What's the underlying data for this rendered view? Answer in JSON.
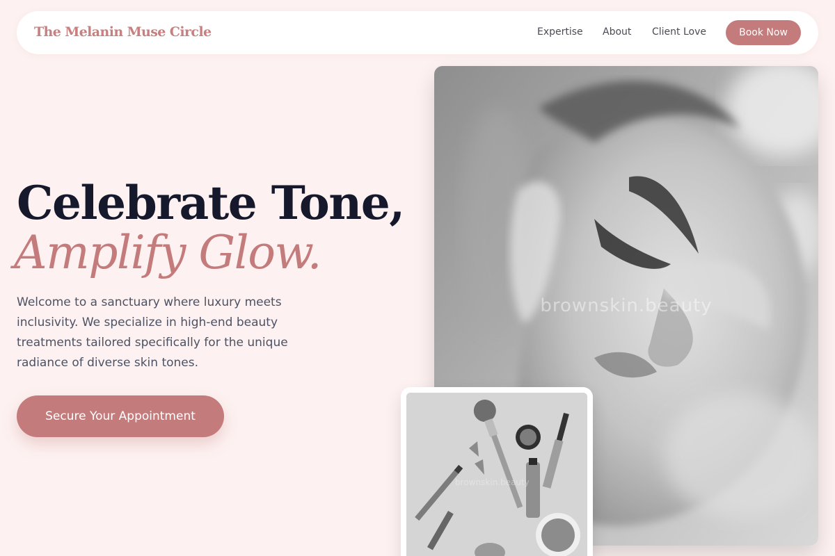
{
  "nav": {
    "brand": "The Melanin Muse Circle",
    "links": [
      "Expertise",
      "About",
      "Client Love"
    ],
    "book_label": "Book Now"
  },
  "hero": {
    "headline_line1": "Celebrate Tone,",
    "headline_line2": "Amplify Glow.",
    "intro": "Welcome to a sanctuary where luxury meets inclusivity. We specialize in high-end beauty treatments tailored specifically for the unique radiance of diverse skin tones.",
    "cta_label": "Secure Your Appointment"
  },
  "images": {
    "main_watermark": "brownskin.beauty",
    "secondary_watermark": "brownskin.beauty"
  },
  "colors": {
    "page_bg": "#fdf2f1",
    "accent": "#c47b7b",
    "heading": "#16182b",
    "body_text": "#4c5264"
  }
}
